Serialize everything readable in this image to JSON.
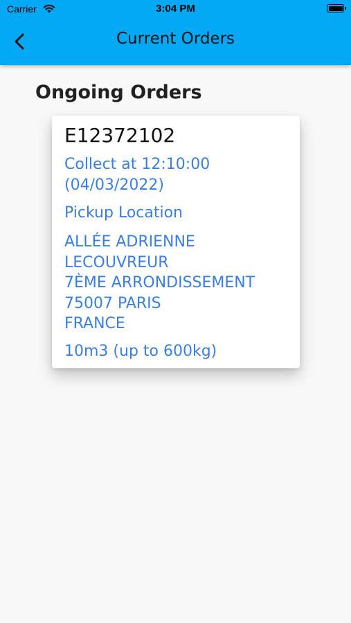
{
  "status_bar": {
    "carrier": "Carrier",
    "time": "3:04 PM"
  },
  "app_bar": {
    "title": "Current Orders",
    "back_icon": "chevron-left-icon",
    "color": "#03a9f4"
  },
  "main": {
    "section_title": "Ongoing Orders",
    "orders": [
      {
        "id": "E12372102",
        "collect_line1": "Collect at 12:10:00",
        "collect_line2": "(04/03/2022)",
        "pickup_label": "Pickup Location",
        "address_lines": [
          "ALLÉE ADRIENNE",
          "LECOUVREUR",
          "7ÈME ARRONDISSEMENT",
          "75007 PARIS",
          "FRANCE"
        ],
        "vehicle": "10m3 (up to 600kg)",
        "text_color": "#3a7fde"
      }
    ]
  }
}
